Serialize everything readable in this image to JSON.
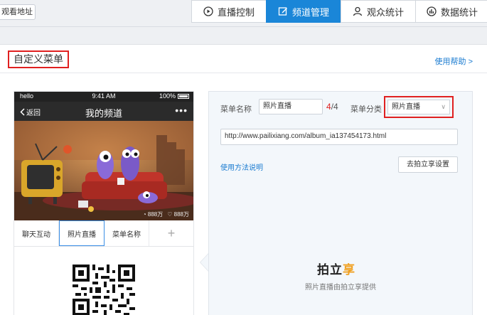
{
  "topbar": {
    "watch_label": "观看地址",
    "tabs": [
      {
        "label": "直播控制",
        "icon": "play-circle-icon",
        "active": false
      },
      {
        "label": "频道管理",
        "icon": "edit-icon",
        "active": true
      },
      {
        "label": "观众统计",
        "icon": "user-icon",
        "active": false
      },
      {
        "label": "数据统计",
        "icon": "chart-icon",
        "active": false
      }
    ]
  },
  "panel": {
    "title": "自定义菜单",
    "help_link": "使用帮助 >"
  },
  "phone": {
    "status": {
      "carrier": "hello",
      "time": "9:41 AM",
      "battery": "100%"
    },
    "nav": {
      "back": "返回",
      "title": "我的频道",
      "more": "•••"
    },
    "hero_stats": {
      "views": "888万",
      "likes": "888万"
    },
    "menu_tabs": [
      "聊天互动",
      "照片直播",
      "菜单名称",
      "+"
    ]
  },
  "settings": {
    "name_label": "菜单名称",
    "name_value": "照片直播",
    "count_current": "4",
    "count_total": "/4",
    "category_label": "菜单分类",
    "category_value": "照片直播",
    "url_value": "http://www.pailixiang.com/album_ia137454173.html",
    "usage_link": "使用方法说明",
    "go_button": "去拍立享设置",
    "brand_a": "拍立",
    "brand_b": "享",
    "brand_note": "照片直播由拍立享提供"
  },
  "colors": {
    "accent": "#1a86d8",
    "highlight": "#e02020"
  }
}
